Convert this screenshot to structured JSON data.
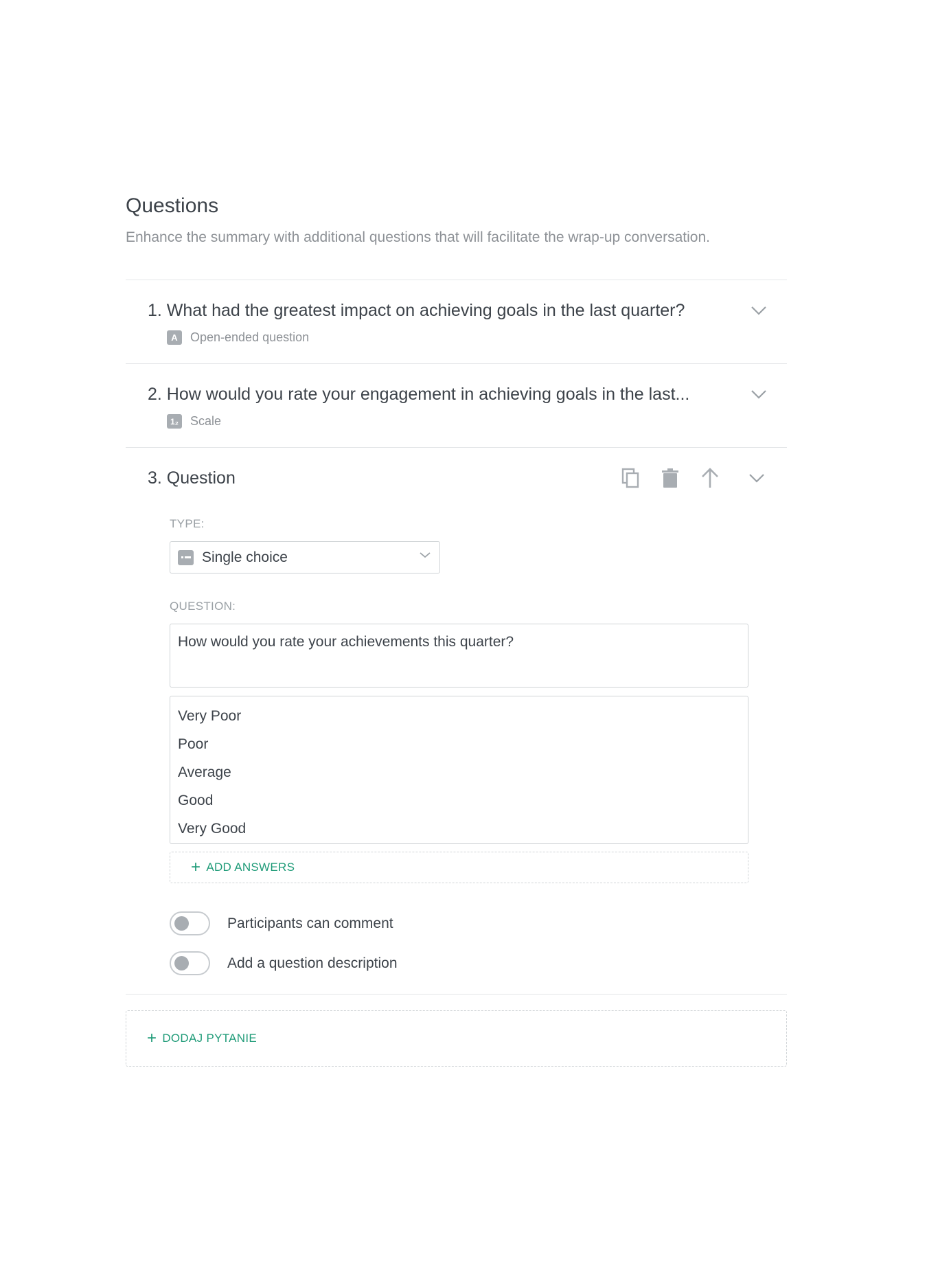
{
  "header": {
    "title": "Questions",
    "description": "Enhance the summary with additional questions that will facilitate the wrap-up conversation."
  },
  "questions": [
    {
      "title": "1. What had the greatest impact on achieving goals in the last quarter?",
      "type_icon": "A",
      "type_label": "Open-ended question"
    },
    {
      "title": "2. How would you rate your engagement in achieving goals in the last...",
      "type_icon": "1₂",
      "type_label": "Scale"
    },
    {
      "title": "3. Question"
    }
  ],
  "editor": {
    "type_label": "TYPE:",
    "type_value": "Single choice",
    "question_label": "QUESTION:",
    "question_value": "How would you rate your achievements this quarter?",
    "answers": [
      "Very Poor",
      "Poor",
      "Average",
      "Good",
      "Very Good"
    ],
    "add_answers_label": "ADD ANSWERS",
    "toggles": [
      {
        "label": "Participants can comment",
        "on": false
      },
      {
        "label": "Add a question description",
        "on": false
      }
    ]
  },
  "add_question_label": "DODAJ PYTANIE",
  "colors": {
    "accent": "#1f9b78",
    "text": "#3d434a",
    "muted": "#8d9196",
    "border": "#cfd3d6"
  }
}
